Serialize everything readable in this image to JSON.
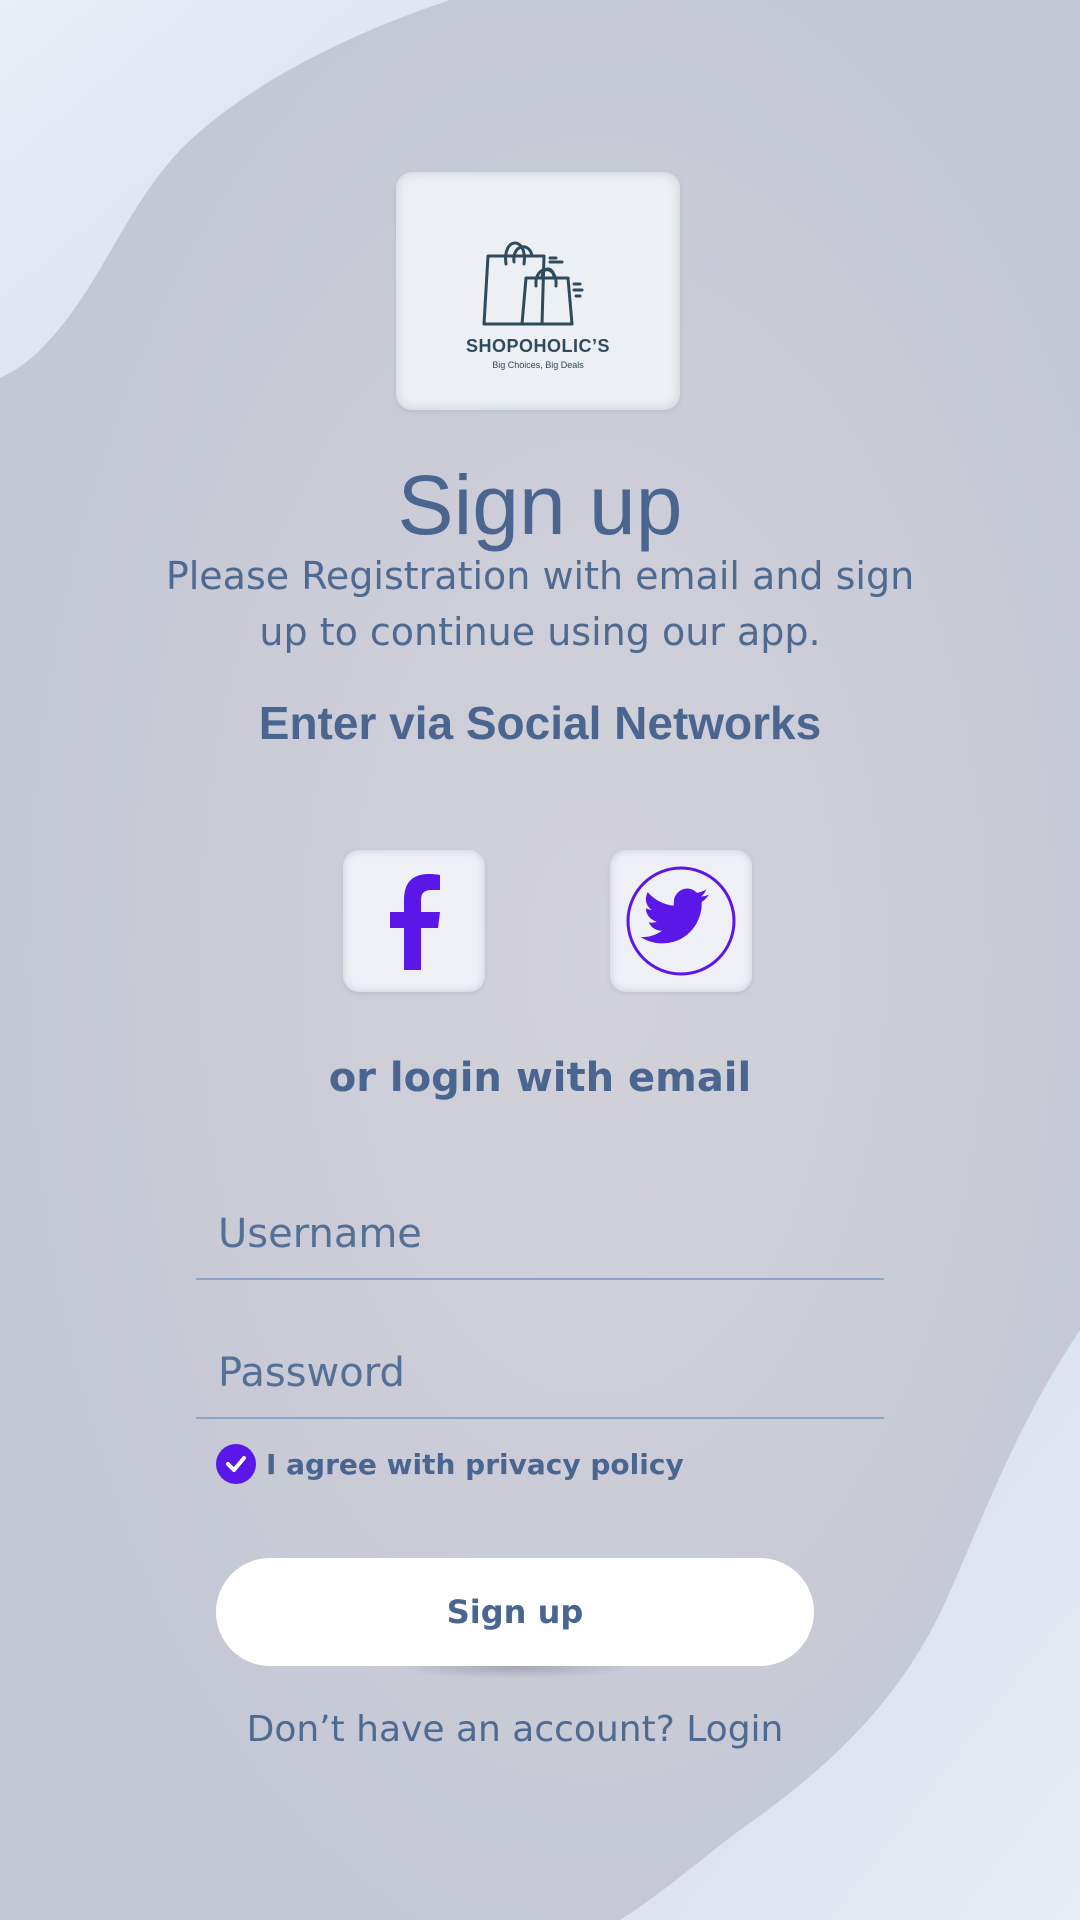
{
  "brand": {
    "name": "SHOPOHOLIC’S",
    "tagline": "Big Choices, Big Deals",
    "logo_icon": "shopping-bags-icon"
  },
  "header": {
    "title": "Sign up",
    "subtitle": "Please Registration with email and sign up to continue using our app."
  },
  "social": {
    "heading": "Enter via Social Networks",
    "buttons": [
      {
        "name": "facebook",
        "icon": "facebook-icon"
      },
      {
        "name": "twitter",
        "icon": "twitter-icon"
      }
    ],
    "accent_color": "#5a17e8"
  },
  "email_section": {
    "heading": "or login with email",
    "username": {
      "placeholder": "Username",
      "value": ""
    },
    "password": {
      "placeholder": "Password",
      "value": ""
    },
    "agree": {
      "label": "I agree with privacy policy",
      "checked": true
    }
  },
  "actions": {
    "signup_label": "Sign up",
    "footer_prompt": "Don’t have an account?",
    "footer_link": "Login"
  },
  "colors": {
    "text_primary": "#4a6690",
    "accent": "#5a17e8",
    "background": "#c5c8d5"
  }
}
